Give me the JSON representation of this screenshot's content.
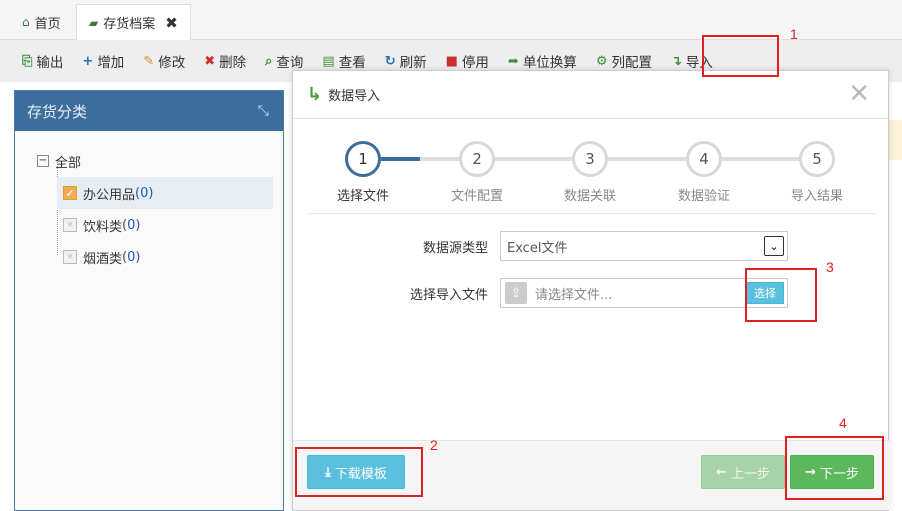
{
  "tabs": [
    {
      "label": "首页",
      "icon": "home-icon"
    },
    {
      "label": "存货档案",
      "icon": "folder-open-icon",
      "close": "✖"
    }
  ],
  "toolbar": [
    {
      "label": "输出",
      "icon": "export-icon",
      "glyph": "⎘",
      "color": "#3c8d3c"
    },
    {
      "label": "增加",
      "icon": "plus-icon",
      "glyph": "+",
      "color": "#1f6fb4"
    },
    {
      "label": "修改",
      "icon": "edit-icon",
      "glyph": "✎",
      "color": "#e08a28"
    },
    {
      "label": "删除",
      "icon": "delete-icon",
      "glyph": "✖",
      "color": "#c9302c"
    },
    {
      "label": "查询",
      "icon": "search-icon",
      "glyph": "⌕",
      "color": "#3c8d3c"
    },
    {
      "label": "查看",
      "icon": "view-icon",
      "glyph": "▤",
      "color": "#3c8d3c"
    },
    {
      "label": "刷新",
      "icon": "refresh-icon",
      "glyph": "↻",
      "color": "#1f6fb4"
    },
    {
      "label": "停用",
      "icon": "stop-icon",
      "glyph": "■",
      "color": "#c9302c"
    },
    {
      "label": "单位换算",
      "icon": "share-icon",
      "glyph": "➦",
      "color": "#3c8d3c"
    },
    {
      "label": "列配置",
      "icon": "gear-icon",
      "glyph": "⚙",
      "color": "#3c8d3c"
    },
    {
      "label": "导入",
      "icon": "import-icon",
      "glyph": "↴",
      "color": "#3c8d3c"
    }
  ],
  "left_panel": {
    "title": "存货分类",
    "tree": {
      "root": {
        "label": "全部",
        "toggle": "−"
      },
      "children": [
        {
          "label": "办公用品",
          "count": "(0)",
          "checked": true
        },
        {
          "label": "饮料类",
          "count": "(0)",
          "checked": false
        },
        {
          "label": "烟酒类",
          "count": "(0)",
          "checked": false
        }
      ]
    }
  },
  "modal": {
    "title": "数据导入",
    "close": "✕",
    "steps": [
      {
        "num": "1",
        "label": "选择文件",
        "active": true
      },
      {
        "num": "2",
        "label": "文件配置",
        "active": false
      },
      {
        "num": "3",
        "label": "数据关联",
        "active": false
      },
      {
        "num": "4",
        "label": "数据验证",
        "active": false
      },
      {
        "num": "5",
        "label": "导入结果",
        "active": false
      }
    ],
    "form": {
      "source_type_label": "数据源类型",
      "source_type_value": "Excel文件",
      "file_label": "选择导入文件",
      "file_placeholder": "请选择文件...",
      "pick_button": "选择"
    },
    "footer": {
      "download_label": "下载模板",
      "prev_label": "上一步",
      "next_label": "下一步"
    }
  },
  "annotations": [
    "1",
    "2",
    "3",
    "4"
  ],
  "colors": {
    "header_blue": "#3c6d9c",
    "info_blue": "#5bc0de",
    "success_green": "#5cb85c",
    "annotation_red": "#e02020"
  }
}
